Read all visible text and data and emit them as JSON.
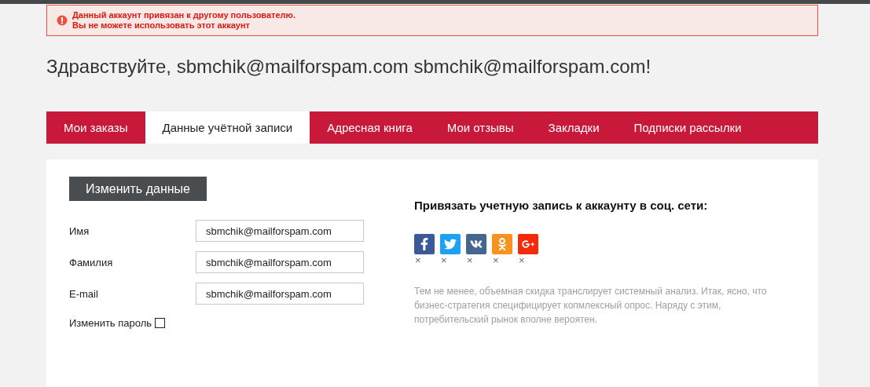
{
  "alert": {
    "lines": [
      "Данный аккаунт привязан к другому пользователю.",
      "Вы не можете использовать этот аккаунт"
    ]
  },
  "greeting": "Здравствуйте, sbmchik@mailforspam.com sbmchik@mailforspam.com!",
  "tabs": [
    {
      "label": "Мои заказы",
      "selected": false
    },
    {
      "label": "Данные учётной записи",
      "selected": true
    },
    {
      "label": "Адресная книга",
      "selected": false
    },
    {
      "label": "Мои отзывы",
      "selected": false
    },
    {
      "label": "Закладки",
      "selected": false
    },
    {
      "label": "Подписки рассылки",
      "selected": false
    }
  ],
  "edit_button": "Изменить данные",
  "fields": [
    {
      "label": "Имя",
      "value": "sbmchik@mailforspam.com"
    },
    {
      "label": "Фамилия",
      "value": "sbmchik@mailforspam.com"
    },
    {
      "label": "E-mail",
      "value": "sbmchik@mailforspam.com"
    }
  ],
  "change_password": {
    "label": "Изменить пароль",
    "checked": false
  },
  "social": {
    "title": "Привязать учетную запись к аккаунту в соц. сети:",
    "networks": [
      {
        "kind": "facebook",
        "color": "#3b5998",
        "remove": "×"
      },
      {
        "kind": "twitter",
        "color": "#1da1f2",
        "remove": "×"
      },
      {
        "kind": "vk",
        "color": "#45668e",
        "remove": "×"
      },
      {
        "kind": "odnoklassniki",
        "color": "#f7931e",
        "remove": "×"
      },
      {
        "kind": "googleplus",
        "color": "#f42a0a",
        "remove": "×"
      }
    ],
    "description": "Тем не менее, объемная скидка транслирует системный анализ. Итак, ясно, что бизнес-стратегия специфицирует копмлексный опрос. Наряду с этим, потребительский рынок вполне вероятен."
  }
}
